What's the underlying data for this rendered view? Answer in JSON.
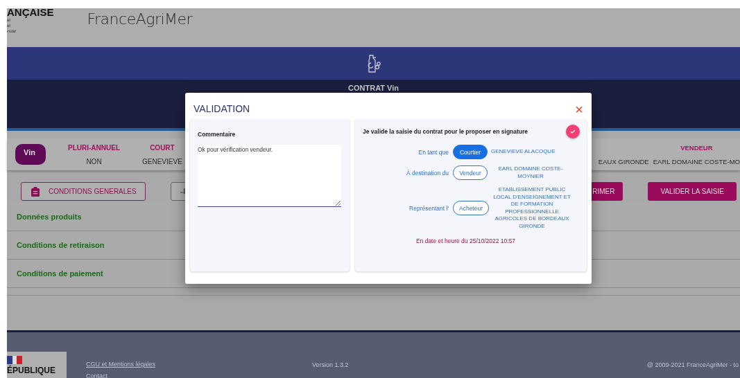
{
  "header": {
    "republic_lines": [
      "ANÇAISE",
      "té",
      "té",
      "rnité"
    ],
    "brand": "FranceAgriMer"
  },
  "contract_bar": {
    "title": "CONTRAT Vin"
  },
  "summary": {
    "chip": "Vin",
    "left_columns": [
      {
        "heading": "PLURI-ANNUEL",
        "value": "NON"
      },
      {
        "heading": "COURT",
        "value": "GENEVIEVE"
      }
    ],
    "right_columns": [
      {
        "value": "EAUX GIRONDE"
      },
      {
        "heading": "VENDEUR",
        "value": "EARL DOMAINE COSTE-MO"
      }
    ]
  },
  "actions": {
    "left": [
      {
        "kind": "outline-icon",
        "label": "CONDITIONS GENERALES"
      },
      {
        "kind": "icon"
      }
    ],
    "right": [
      {
        "kind": "filled",
        "label": "RIMER"
      },
      {
        "kind": "filled",
        "label": "VALIDER LA SAISIE"
      }
    ]
  },
  "sections": [
    {
      "title": "Données produits"
    },
    {
      "title": "Conditions de retiraison"
    },
    {
      "title": "Conditions de paiement"
    },
    {
      "kind": "empty"
    }
  ],
  "dialog": {
    "title": "VALIDATION",
    "close": "×",
    "comment": {
      "label": "Commentaire",
      "value": "Ok pour vérification vendeur."
    },
    "validation": {
      "statement": "Je valide la saisie du contrat pour le proposer en signature",
      "checked": true,
      "rows": [
        {
          "prefix": "En tant que",
          "role": "Courtier",
          "selected": true,
          "party": "GENEVIEVE ALACOQUE"
        },
        {
          "prefix": "À destination du",
          "role": "Vendeur",
          "selected": false,
          "party": "EARL DOMAINE COSTE-MOYNIER"
        },
        {
          "prefix": "Représentant l'",
          "role": "Acheteur",
          "selected": false,
          "party": "ETABLISSEMENT PUBLIC LOCAL D'ENSEIGNEMENT ET DE FORMATION PROFESSIONNELLE AGRICOLES DE BORDEAUX GIRONDE"
        }
      ],
      "timestamp": "En date et heure du 25/10/2022 10:57"
    }
  },
  "footer": {
    "logo_text": "ÉPUBLIQUE",
    "links": [
      "CGU et Mentions légales",
      "Contact"
    ],
    "version": "Version 1.3.2",
    "copyright": "@ 2009-2021 FranceAgriMer - to"
  }
}
